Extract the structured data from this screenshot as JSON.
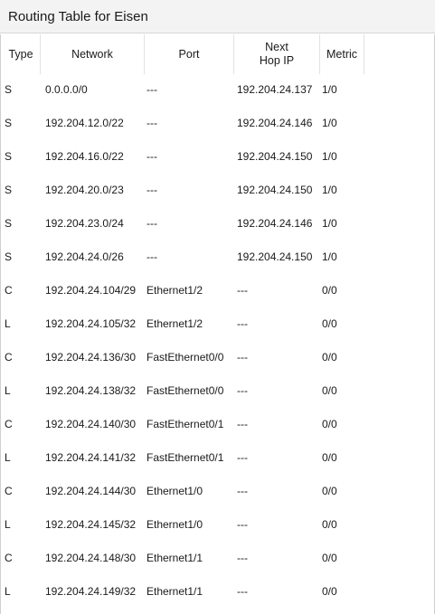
{
  "window": {
    "title": "Routing Table for Eisen"
  },
  "table": {
    "columns": [
      "Type",
      "Network",
      "Port",
      "Next\nHop IP",
      "Metric"
    ],
    "rows": [
      {
        "type": "S",
        "network": "0.0.0.0/0",
        "port": "---",
        "next_hop": "192.204.24.137",
        "metric": "1/0"
      },
      {
        "type": "S",
        "network": "192.204.12.0/22",
        "port": "---",
        "next_hop": "192.204.24.146",
        "metric": "1/0"
      },
      {
        "type": "S",
        "network": "192.204.16.0/22",
        "port": "---",
        "next_hop": "192.204.24.150",
        "metric": "1/0"
      },
      {
        "type": "S",
        "network": "192.204.20.0/23",
        "port": "---",
        "next_hop": "192.204.24.150",
        "metric": "1/0"
      },
      {
        "type": "S",
        "network": "192.204.23.0/24",
        "port": "---",
        "next_hop": "192.204.24.146",
        "metric": "1/0"
      },
      {
        "type": "S",
        "network": "192.204.24.0/26",
        "port": "---",
        "next_hop": "192.204.24.150",
        "metric": "1/0"
      },
      {
        "type": "C",
        "network": "192.204.24.104/29",
        "port": "Ethernet1/2",
        "next_hop": "---",
        "metric": "0/0"
      },
      {
        "type": "L",
        "network": "192.204.24.105/32",
        "port": "Ethernet1/2",
        "next_hop": "---",
        "metric": "0/0"
      },
      {
        "type": "C",
        "network": "192.204.24.136/30",
        "port": "FastEthernet0/0",
        "next_hop": "---",
        "metric": "0/0"
      },
      {
        "type": "L",
        "network": "192.204.24.138/32",
        "port": "FastEthernet0/0",
        "next_hop": "---",
        "metric": "0/0"
      },
      {
        "type": "C",
        "network": "192.204.24.140/30",
        "port": "FastEthernet0/1",
        "next_hop": "---",
        "metric": "0/0"
      },
      {
        "type": "L",
        "network": "192.204.24.141/32",
        "port": "FastEthernet0/1",
        "next_hop": "---",
        "metric": "0/0"
      },
      {
        "type": "C",
        "network": "192.204.24.144/30",
        "port": "Ethernet1/0",
        "next_hop": "---",
        "metric": "0/0"
      },
      {
        "type": "L",
        "network": "192.204.24.145/32",
        "port": "Ethernet1/0",
        "next_hop": "---",
        "metric": "0/0"
      },
      {
        "type": "C",
        "network": "192.204.24.148/30",
        "port": "Ethernet1/1",
        "next_hop": "---",
        "metric": "0/0"
      },
      {
        "type": "L",
        "network": "192.204.24.149/32",
        "port": "Ethernet1/1",
        "next_hop": "---",
        "metric": "0/0"
      }
    ]
  }
}
